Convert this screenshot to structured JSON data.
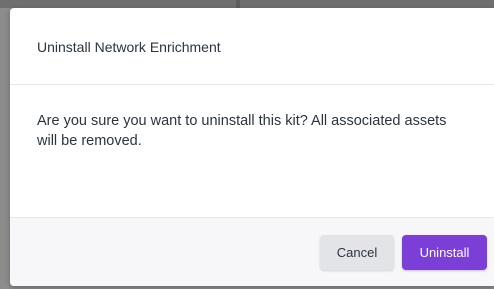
{
  "dialog": {
    "title": "Uninstall Network Enrichment",
    "message": "Are you sure you want to uninstall this kit? All associated assets will be removed.",
    "cancel_label": "Cancel",
    "confirm_label": "Uninstall"
  },
  "colors": {
    "primary": "#7b3fd8",
    "cancel_bg": "#e2e4e8",
    "text": "#2b3440"
  }
}
